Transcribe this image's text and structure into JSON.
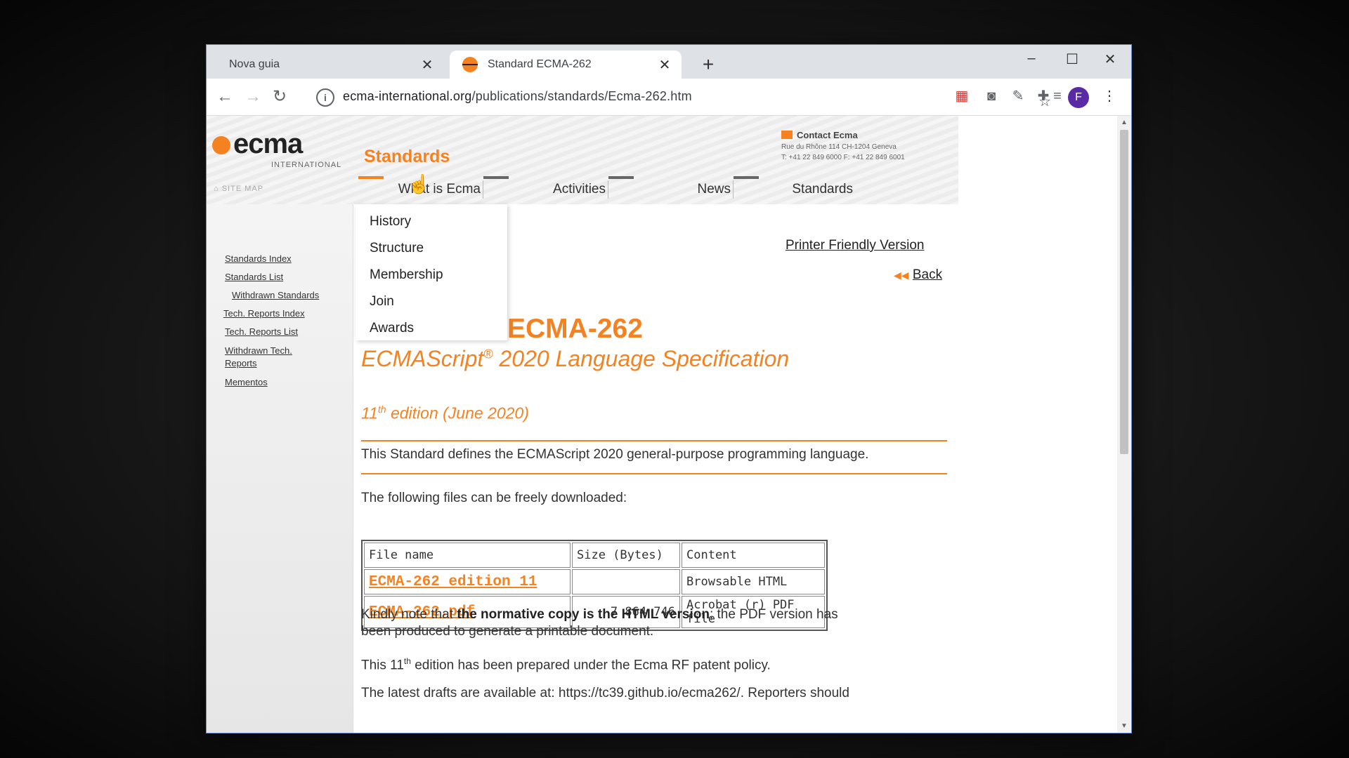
{
  "browser": {
    "tabs": [
      {
        "title": "Nova guia",
        "active": false
      },
      {
        "title": "Standard ECMA-262",
        "active": true
      }
    ],
    "close_glyph": "✕",
    "new_tab_glyph": "+",
    "window_controls": {
      "minimize": "–",
      "maximize": "☐",
      "close": "✕"
    },
    "url_domain": "ecma-international.org",
    "url_path": "/publications/standards/Ecma-262.htm",
    "profile_initial": "F"
  },
  "header": {
    "logo": "ecma",
    "logo_sub": "INTERNATIONAL",
    "section_title": "Standards",
    "contact_title": "Contact Ecma",
    "contact_address": "Rue du Rhône 114   CH-1204 Geneva",
    "contact_phone": "T: +41 22 849 6000 F: +41 22 849 6001",
    "sitemap": "SITE MAP",
    "menu": [
      "What is Ecma",
      "Activities",
      "News",
      "Standards"
    ]
  },
  "dropdown": [
    "History",
    "Structure",
    "Membership",
    "Join",
    "Awards"
  ],
  "sidebar": [
    "Standards Index",
    "Standards List",
    "Withdrawn Standards",
    "Tech. Reports Index",
    "Tech. Reports List",
    "Withdrawn Tech. Reports",
    "Mementos"
  ],
  "main": {
    "printer_friendly": "Printer Friendly Version",
    "back": "Back",
    "heading": "ECMA-262",
    "subtitle_pre": "ECMAScript",
    "subtitle_reg": "®",
    "subtitle_post": " 2020 Language Specification",
    "edition_num": "11",
    "edition_sup": "th",
    "edition_rest": " edition (June 2020)",
    "description": "This Standard defines the ECMAScript 2020 general-purpose programming language.",
    "downloads_intro": "The following files can be freely downloaded:",
    "table": {
      "headers": [
        "File name",
        "Size (Bytes)",
        "Content"
      ],
      "rows": [
        [
          "ECMA-262 edition 11",
          "",
          "Browsable HTML"
        ],
        [
          "ECMA-262.pdf",
          "7 864 746",
          "Acrobat (r) PDF file"
        ]
      ]
    },
    "note_pre": "Kindly note that ",
    "note_bold": "the normative copy is the HTML version",
    "note_post": "; the PDF version has",
    "note_line2": "been produced to generate a printable document.",
    "patent_pre": "This 11",
    "patent_sup": "th",
    "patent_post": " edition has been prepared under the Ecma RF patent policy.",
    "drafts_line": "The latest drafts are available at: https://tc39.github.io/ecma262/. Reporters should"
  }
}
